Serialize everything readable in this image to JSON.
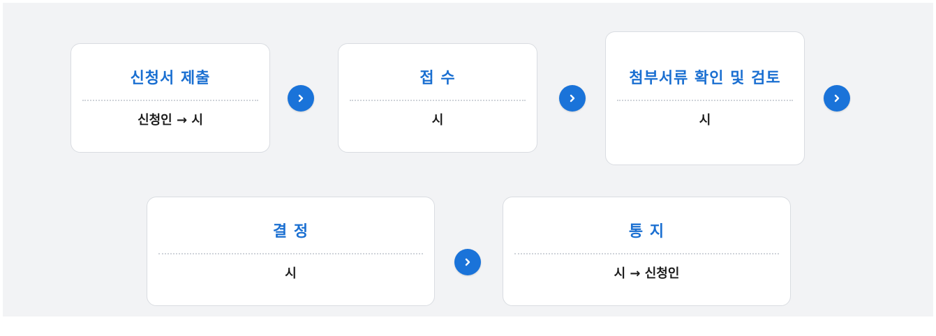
{
  "steps": [
    {
      "title": "신청서 제출",
      "desc": "신청인 → 시"
    },
    {
      "title": "접 수",
      "desc": "시"
    },
    {
      "title": "첨부서류 확인 및 검토",
      "desc": "시"
    },
    {
      "title": "결 정",
      "desc": "시"
    },
    {
      "title": "통 지",
      "desc": "시 → 신청인"
    }
  ],
  "colors": {
    "accent": "#1a6fd1",
    "arrow": "#1a73d9",
    "panel": "#f2f3f5"
  },
  "icons": {
    "arrow": "chevron-right-icon"
  }
}
